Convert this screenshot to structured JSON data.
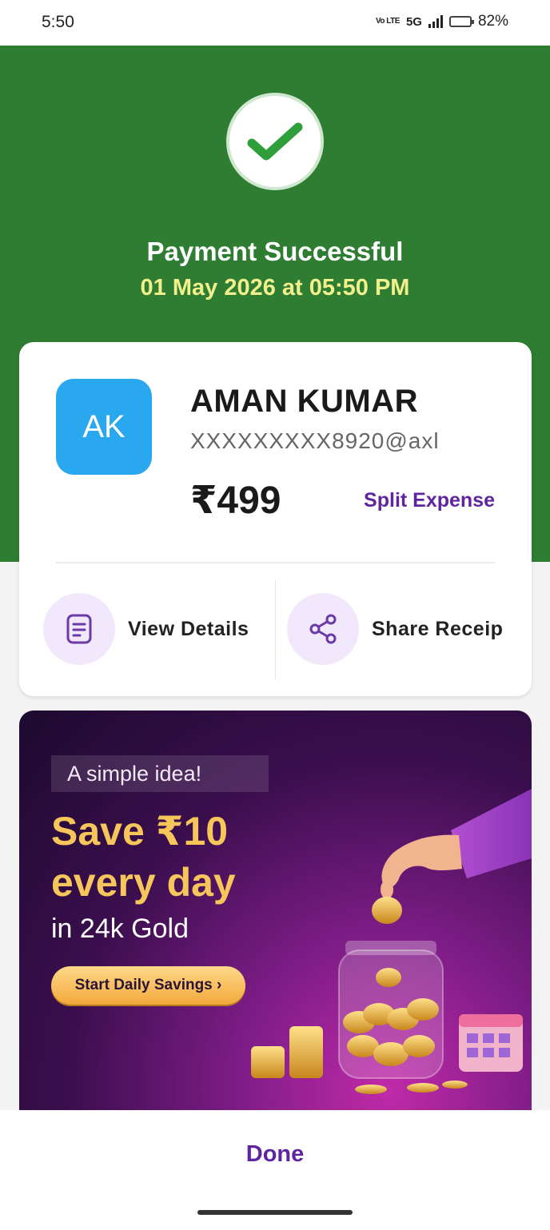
{
  "status_bar": {
    "time": "5:50",
    "volte": "Vo LTE",
    "network": "5G",
    "battery_percent": "82%",
    "battery_level": 0.82
  },
  "header": {
    "title": "Payment Successful",
    "datetime": "01 May 2026 at 05:50 PM",
    "background_color": "#2e7d32"
  },
  "payee": {
    "initials": "AK",
    "name": "AMAN KUMAR",
    "upi_id": "XXXXXXXXX8920@axl",
    "amount": "₹499",
    "avatar_color": "#2aa8ef"
  },
  "actions": {
    "split_expense": "Split Expense",
    "view_details": "View Details",
    "share_receipt": "Share Receip"
  },
  "banner": {
    "tag": "A simple idea!",
    "headline_1": "Save ₹10",
    "headline_2": "every day",
    "subline": "in 24k Gold",
    "cta": "Start Daily Savings ›"
  },
  "footer": {
    "done_label": "Done"
  },
  "colors": {
    "accent_purple": "#5f259f",
    "gold": "#f6c65a",
    "date_yellow": "#f2f08c"
  }
}
